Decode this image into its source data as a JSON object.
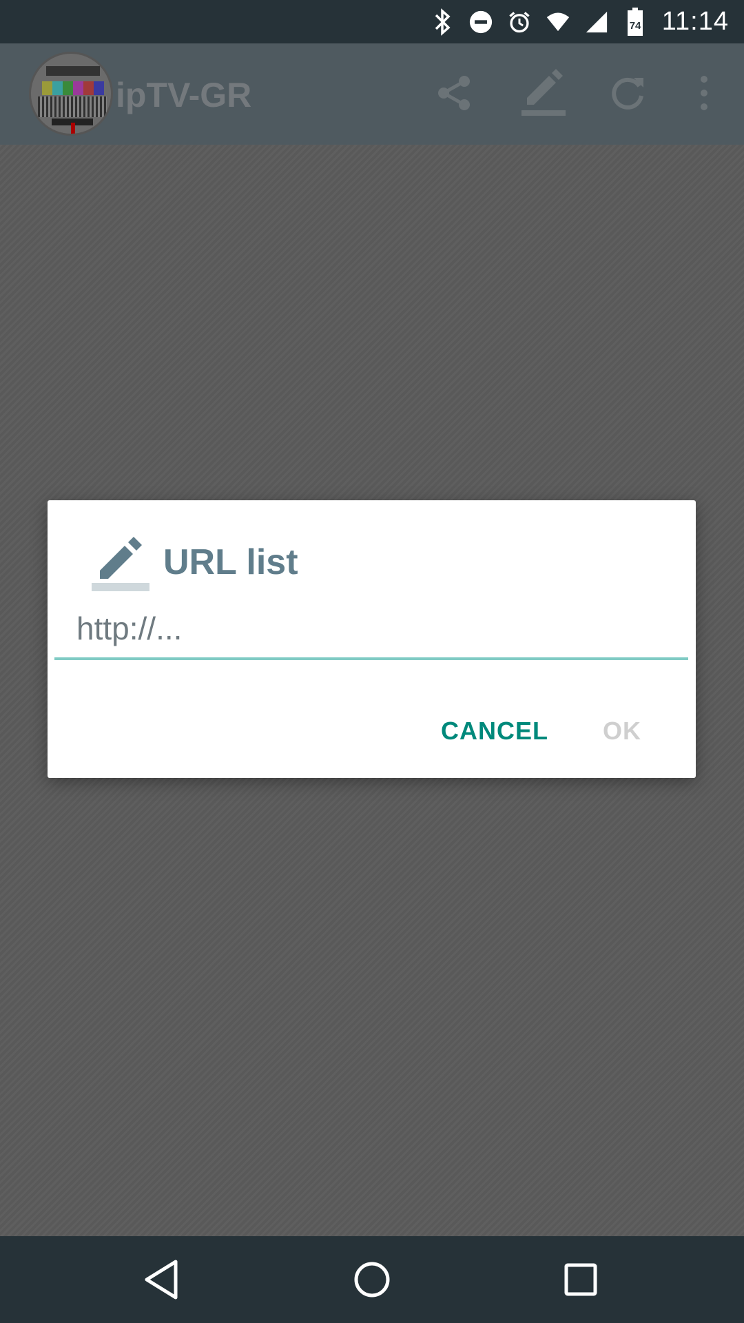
{
  "status_bar": {
    "time": "11:14",
    "battery_level": "74",
    "icons": [
      "bluetooth-icon",
      "do-not-disturb-icon",
      "alarm-icon",
      "wifi-icon",
      "signal-icon",
      "battery-icon"
    ]
  },
  "app_bar": {
    "title": "ipTV-GR",
    "actions": [
      "share-icon",
      "edit-icon",
      "refresh-icon",
      "more-vert-icon"
    ]
  },
  "dialog": {
    "title": "URL list",
    "title_icon": "edit-icon",
    "input": {
      "value": "",
      "placeholder": "http://..."
    },
    "cancel_label": "CANCEL",
    "ok_label": "OK"
  },
  "nav_bar": {
    "buttons": [
      "back-icon",
      "home-icon",
      "recents-icon"
    ]
  },
  "colors": {
    "accent": "#00897b",
    "input_underline": "#80cbc4",
    "title": "#607d8b",
    "status_bar": "#263238"
  }
}
